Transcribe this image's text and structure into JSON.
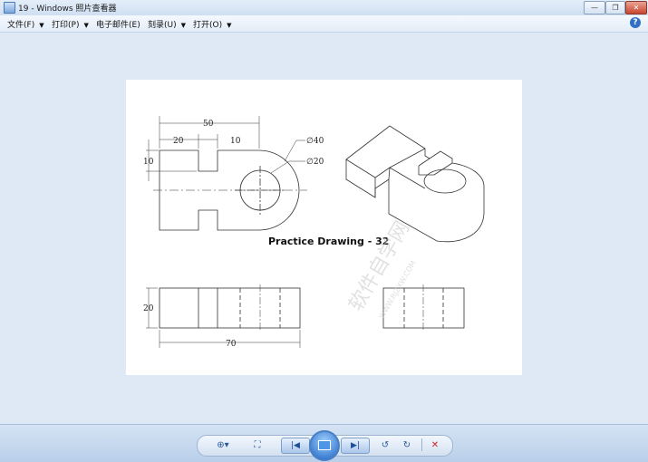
{
  "window": {
    "title": "19 - Windows 照片查看器"
  },
  "menu": {
    "items": [
      {
        "label": "文件(F)"
      },
      {
        "label": "打印(P)"
      },
      {
        "label": "电子邮件(E)"
      },
      {
        "label": "刻录(U)"
      },
      {
        "label": "打开(O)"
      }
    ],
    "help": "?"
  },
  "drawing": {
    "title": "Practice Drawing - 32",
    "dims": {
      "d50": "50",
      "d20": "20",
      "d10a": "10",
      "d10b": "10",
      "phi40": "∅40",
      "phi20": "∅20",
      "h20": "20",
      "w70": "70"
    },
    "watermark": {
      "big": "软件自学网",
      "small": "WWW.RJZXW.COM"
    }
  },
  "toolbar": {
    "zoom_icon": "magnifier-icon",
    "fit_icon": "actual-size-icon",
    "prev_icon": "previous-icon",
    "slideshow_icon": "slideshow-icon",
    "next_icon": "next-icon",
    "rotate_ccw_icon": "rotate-counterclockwise-icon",
    "rotate_cw_icon": "rotate-clockwise-icon",
    "delete_icon": "delete-icon"
  }
}
